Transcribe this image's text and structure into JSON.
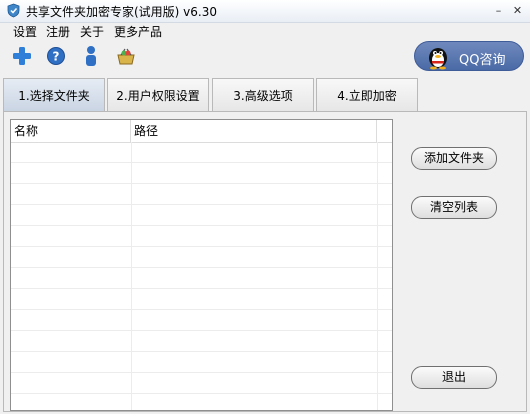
{
  "window": {
    "title": "共享文件夹加密专家(试用版) v6.30"
  },
  "menu": {
    "items": [
      "设置",
      "注册",
      "关于",
      "更多产品"
    ]
  },
  "toolbar": {
    "tools": [
      {
        "icon": "plus-icon"
      },
      {
        "icon": "help-icon"
      },
      {
        "icon": "user-icon"
      },
      {
        "icon": "basket-icon"
      }
    ],
    "qq_label": "QQ咨询"
  },
  "tabs": [
    {
      "label": "1.选择文件夹",
      "active": true
    },
    {
      "label": "2.用户权限设置",
      "active": false
    },
    {
      "label": "3.高级选项",
      "active": false
    },
    {
      "label": "4.立即加密",
      "active": false
    }
  ],
  "list": {
    "columns": [
      "名称",
      "路径"
    ],
    "rows": []
  },
  "actions": {
    "add_folder": "添加文件夹",
    "clear_list": "清空列表",
    "exit": "退出"
  },
  "colors": {
    "qq_button": "#5574b0",
    "tab_active": "#d3dce9",
    "window_bg": "#f0f0f0"
  }
}
